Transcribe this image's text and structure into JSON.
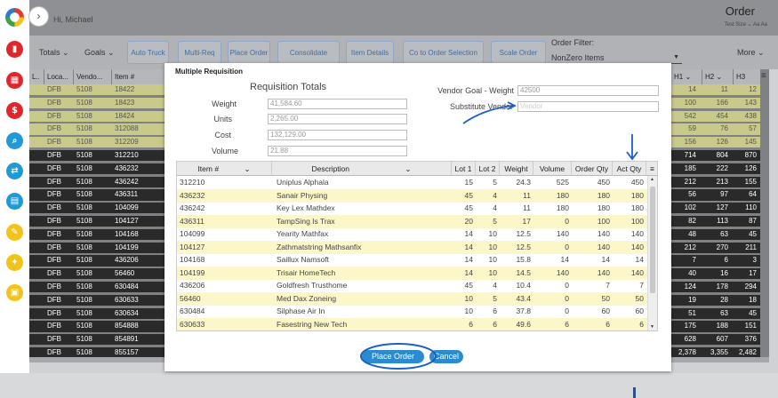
{
  "header": {
    "greeting": "Hi, Michael",
    "title": "Order",
    "subtitle": "Test Size  ⌄  Aa   Aa",
    "expand": "›"
  },
  "toolbar": {
    "totals": "Totals ⌄",
    "goals": "Goals ⌄",
    "auto_truck": "Auto Truck",
    "multi_req": "Multi-Req",
    "place_order": "Place Order",
    "consolidate": "Consolidate",
    "item_details": "Item Details",
    "co_to_order": "Co to Order Selection",
    "scale_order": "Scale Order",
    "order_filter_label": "Order Filter:",
    "order_filter_value": "NonZero Items",
    "more": "More ⌄"
  },
  "sidebar": {
    "icons": [
      "logo-icon",
      "chart-icon",
      "calendar-icon",
      "dollar-icon",
      "search-icon",
      "transfer-icon",
      "document-icon",
      "pencil-icon",
      "wrench-icon",
      "clipboard-icon"
    ]
  },
  "grid": {
    "headers": [
      "L..",
      "Loca...",
      "Vendo...",
      "Item #"
    ],
    "right_headers": [
      "H1 ⌄",
      "H2 ⌄",
      "H3"
    ],
    "rows": [
      {
        "loc": "DFB",
        "vendor": "5108",
        "item": "18422",
        "h1": "14",
        "h2": "11",
        "h3": "12",
        "style": "l"
      },
      {
        "loc": "DFB",
        "vendor": "5108",
        "item": "18423",
        "h1": "100",
        "h2": "166",
        "h3": "143",
        "style": "l"
      },
      {
        "loc": "DFB",
        "vendor": "5108",
        "item": "18424",
        "h1": "542",
        "h2": "454",
        "h3": "438",
        "style": "l"
      },
      {
        "loc": "DFB",
        "vendor": "5108",
        "item": "312088",
        "h1": "59",
        "h2": "76",
        "h3": "57",
        "style": "l"
      },
      {
        "loc": "DFB",
        "vendor": "5108",
        "item": "312209",
        "h1": "156",
        "h2": "126",
        "h3": "145",
        "style": "l"
      },
      {
        "loc": "DFB",
        "vendor": "5108",
        "item": "312210",
        "h1": "714",
        "h2": "804",
        "h3": "870",
        "style": "d"
      },
      {
        "loc": "DFB",
        "vendor": "5108",
        "item": "436232",
        "h1": "185",
        "h2": "222",
        "h3": "126",
        "style": "d"
      },
      {
        "loc": "DFB",
        "vendor": "5108",
        "item": "436242",
        "h1": "212",
        "h2": "213",
        "h3": "155",
        "style": "d"
      },
      {
        "loc": "DFB",
        "vendor": "5108",
        "item": "436311",
        "h1": "56",
        "h2": "97",
        "h3": "64",
        "style": "d"
      },
      {
        "loc": "DFB",
        "vendor": "5108",
        "item": "104099",
        "h1": "102",
        "h2": "127",
        "h3": "110",
        "style": "d"
      },
      {
        "loc": "DFB",
        "vendor": "5108",
        "item": "104127",
        "h1": "82",
        "h2": "113",
        "h3": "87",
        "style": "d"
      },
      {
        "loc": "DFB",
        "vendor": "5108",
        "item": "104168",
        "h1": "48",
        "h2": "63",
        "h3": "45",
        "style": "d"
      },
      {
        "loc": "DFB",
        "vendor": "5108",
        "item": "104199",
        "h1": "212",
        "h2": "270",
        "h3": "211",
        "style": "d"
      },
      {
        "loc": "DFB",
        "vendor": "5108",
        "item": "436206",
        "h1": "7",
        "h2": "6",
        "h3": "3",
        "style": "d"
      },
      {
        "loc": "DFB",
        "vendor": "5108",
        "item": "56460",
        "h1": "40",
        "h2": "16",
        "h3": "17",
        "style": "d"
      },
      {
        "loc": "DFB",
        "vendor": "5108",
        "item": "630484",
        "h1": "124",
        "h2": "178",
        "h3": "294",
        "style": "d"
      },
      {
        "loc": "DFB",
        "vendor": "5108",
        "item": "630633",
        "h1": "19",
        "h2": "28",
        "h3": "18",
        "style": "d"
      },
      {
        "loc": "DFB",
        "vendor": "5108",
        "item": "630634",
        "h1": "51",
        "h2": "63",
        "h3": "45",
        "style": "d"
      },
      {
        "loc": "DFB",
        "vendor": "5108",
        "item": "854888",
        "h1": "175",
        "h2": "188",
        "h3": "151",
        "style": "d"
      },
      {
        "loc": "DFB",
        "vendor": "5108",
        "item": "854891",
        "h1": "628",
        "h2": "607",
        "h3": "376",
        "style": "d"
      },
      {
        "loc": "DFB",
        "vendor": "5108",
        "item": "855157",
        "h1": "2,378",
        "h2": "3,355",
        "h3": "2,482",
        "style": "d"
      }
    ]
  },
  "modal": {
    "title": "Multiple Requisition",
    "totals_heading": "Requisition Totals",
    "weight_label": "Weight",
    "weight": "41,584.60",
    "units_label": "Units",
    "units": "2,265.00",
    "cost_label": "Cost",
    "cost": "132,129.00",
    "volume_label": "Volume",
    "volume": "21.88",
    "vendor_goal_label": "Vendor Goal - Weight",
    "vendor_goal": "42500",
    "substitute_label": "Substitute Vendor",
    "substitute_placeholder": "Vendor",
    "columns": [
      "Item #",
      "Description",
      "Lot 1",
      "Lot 2",
      "Weight",
      "Volume",
      "Order Qty",
      "Act Qty"
    ],
    "rows": [
      [
        "312210",
        "Uniplus Alphala",
        "15",
        "5",
        "24.3",
        "525",
        "450",
        "450"
      ],
      [
        "436232",
        "Sanair Physing",
        "45",
        "4",
        "11",
        "180",
        "180",
        "180"
      ],
      [
        "436242",
        "Key Lex Mathdex",
        "45",
        "4",
        "11",
        "180",
        "180",
        "180"
      ],
      [
        "436311",
        "TampSing Is Trax",
        "20",
        "5",
        "17",
        "0",
        "100",
        "100"
      ],
      [
        "104099",
        "Yearity Mathfax",
        "14",
        "10",
        "12.5",
        "140",
        "140",
        "140"
      ],
      [
        "104127",
        "Zathmatstring Mathsanfix",
        "14",
        "10",
        "12.5",
        "0",
        "140",
        "140"
      ],
      [
        "104168",
        "Saillux Namsoft",
        "14",
        "10",
        "15.8",
        "14",
        "14",
        "14"
      ],
      [
        "104199",
        "Trisair HomeTech",
        "14",
        "10",
        "14.5",
        "140",
        "140",
        "140"
      ],
      [
        "436206",
        "Goldfresh Trusthome",
        "45",
        "4",
        "10.4",
        "0",
        "7",
        "7"
      ],
      [
        "56460",
        "Med Dax Zoneing",
        "10",
        "5",
        "43.4",
        "0",
        "50",
        "50"
      ],
      [
        "630484",
        "Silphase Air In",
        "10",
        "6",
        "37.8",
        "0",
        "60",
        "60"
      ],
      [
        "630633",
        "Fasestring New Tech",
        "6",
        "6",
        "49.6",
        "6",
        "6",
        "6"
      ]
    ],
    "place_order": "Place Order",
    "cancel": "Cancel"
  },
  "colors": {
    "accent": "#2a8bd0",
    "highlight": "#fbf7c8",
    "annotation": "#1d5fc9"
  }
}
